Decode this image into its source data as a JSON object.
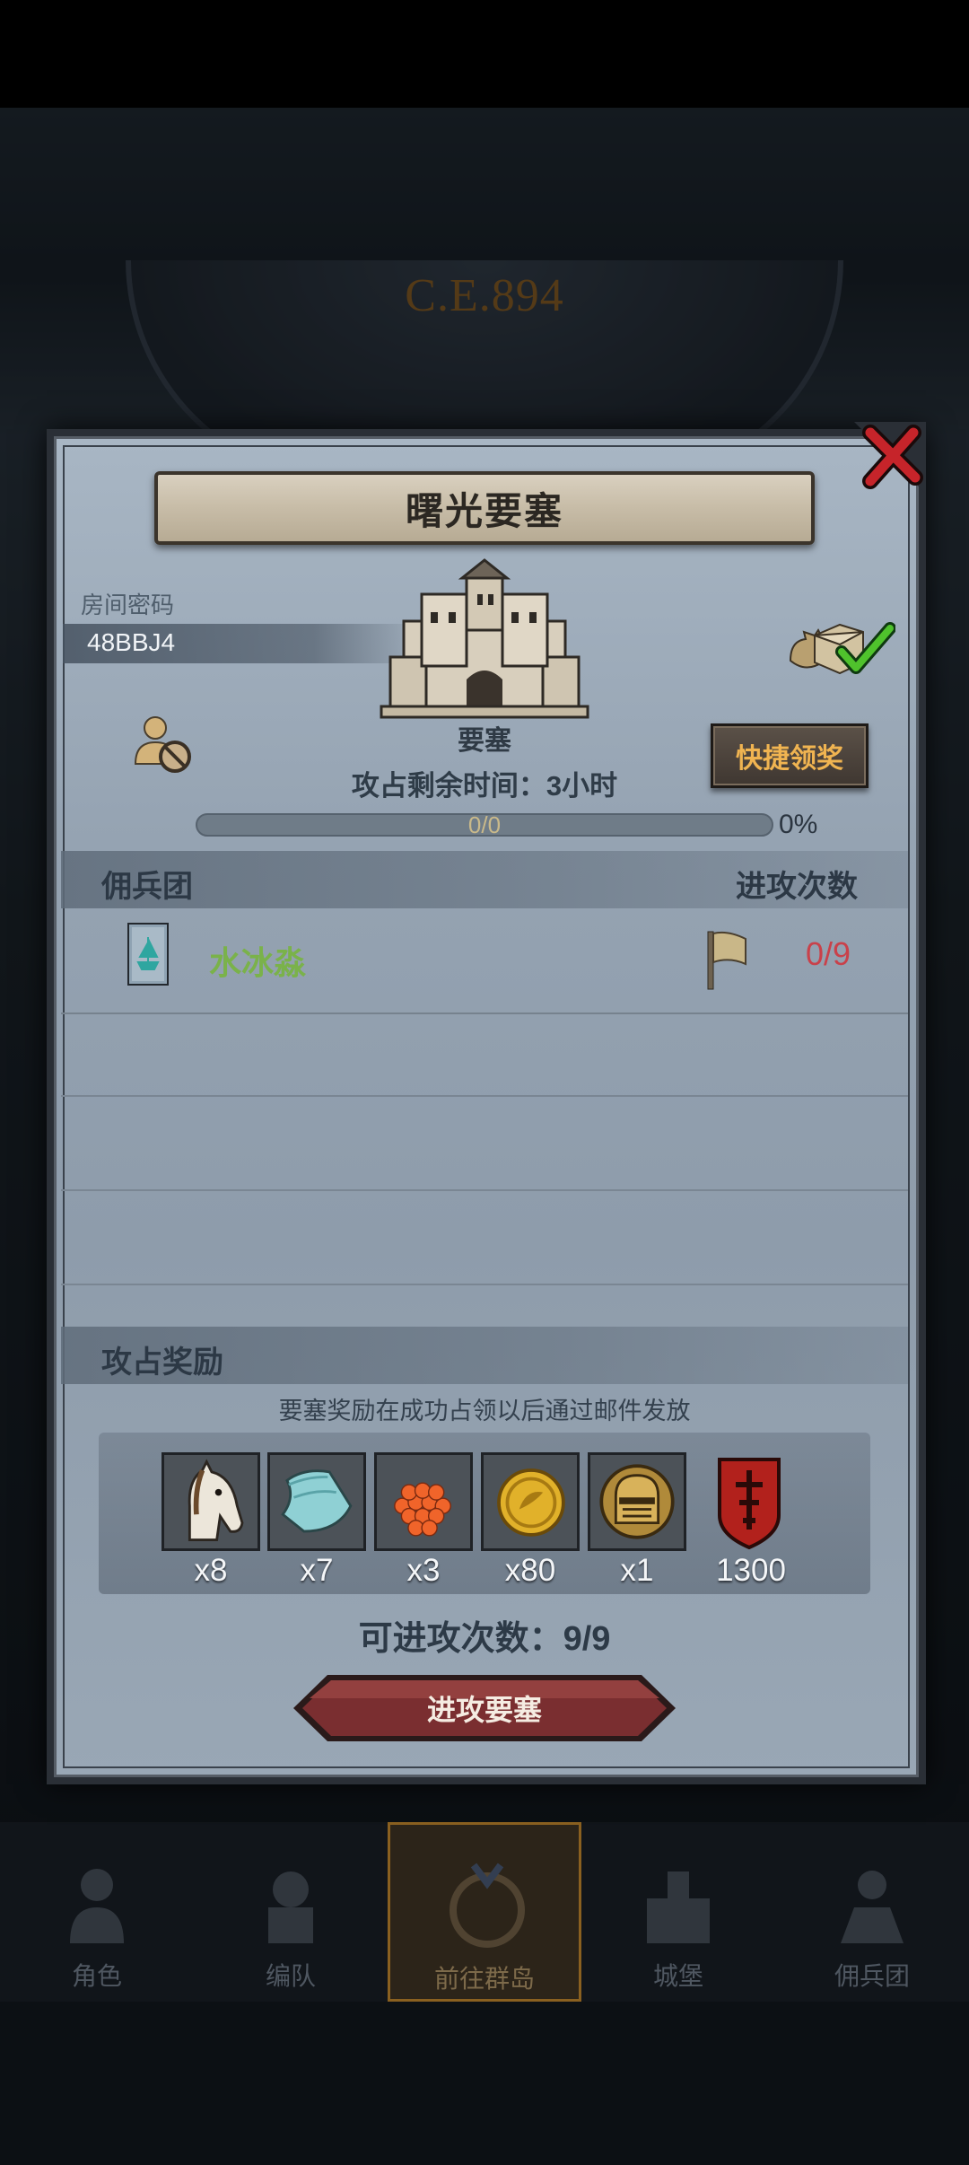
{
  "background": {
    "era_text": "C.E.894"
  },
  "modal": {
    "title": "曙光要塞",
    "room_code_label": "房间密码",
    "room_code": "48BBJ4",
    "building_label": "要塞",
    "quick_claim_label": "快捷领奖",
    "remaining_time": "攻占剩余时间：3小时",
    "progress_text": "0/0",
    "progress_percent": "0%",
    "progress_value": 0,
    "mercenary_header": "佣兵团",
    "attack_count_header": "进攻次数",
    "guilds": [
      {
        "name": "水冰淼",
        "attacks": "0/9"
      }
    ],
    "rewards_header": "攻占奖励",
    "rewards_note": "要塞奖励在成功占领以后通过邮件发放",
    "rewards": [
      {
        "icon": "horse-icon",
        "qty": "x8"
      },
      {
        "icon": "cloth-icon",
        "qty": "x7"
      },
      {
        "icon": "caviar-icon",
        "qty": "x3"
      },
      {
        "icon": "gold-coin-icon",
        "qty": "x80"
      },
      {
        "icon": "knight-helmet-icon",
        "qty": "x1"
      },
      {
        "icon": "red-shield-banner-icon",
        "qty": "1300"
      }
    ],
    "attacks_left": "可进攻次数：9/9",
    "attack_button": "进攻要塞"
  },
  "bottom_nav": [
    {
      "label": "角色",
      "icon": "character-icon",
      "active": false
    },
    {
      "label": "编队",
      "icon": "formation-icon",
      "active": false
    },
    {
      "label": "前往群岛",
      "icon": "islands-icon",
      "active": true
    },
    {
      "label": "城堡",
      "icon": "castle-icon",
      "active": false
    },
    {
      "label": "佣兵团",
      "icon": "mercenary-icon",
      "active": false
    }
  ],
  "colors": {
    "guild_name": "#7ab24a",
    "attack_count": "#c9414a",
    "quick_claim_text": "#f0b451",
    "attack_button": "#7a2e30"
  }
}
